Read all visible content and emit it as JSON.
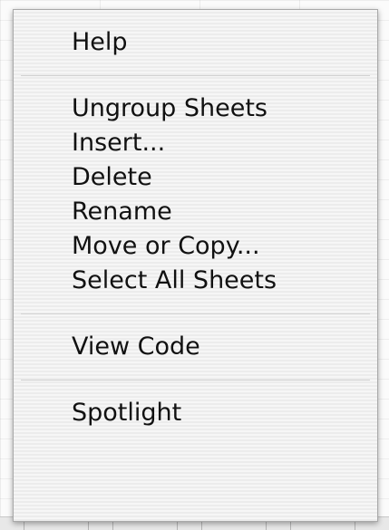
{
  "context_menu": {
    "groups": [
      {
        "items": [
          {
            "label": "Help"
          }
        ]
      },
      {
        "items": [
          {
            "label": "Ungroup Sheets"
          },
          {
            "label": "Insert..."
          },
          {
            "label": "Delete"
          },
          {
            "label": "Rename"
          },
          {
            "label": "Move or Copy..."
          },
          {
            "label": "Select All Sheets"
          }
        ]
      },
      {
        "items": [
          {
            "label": "View Code"
          }
        ]
      },
      {
        "items": [
          {
            "label": "Spotlight"
          }
        ]
      }
    ]
  }
}
